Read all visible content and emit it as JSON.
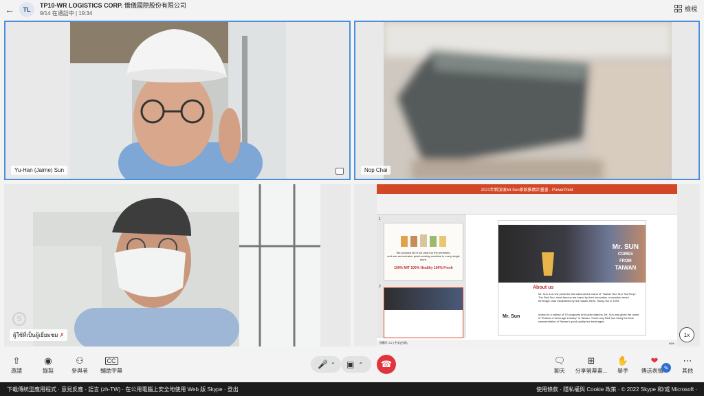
{
  "header": {
    "avatar_initials": "TL",
    "title": "TP10-WR LOGISTICS CORP.",
    "org": "僑儀國際股份有限公司",
    "subtitle": "9/14 在通話中 | 19:34",
    "view_label": "檢視"
  },
  "participants": [
    {
      "name": "Yu-Han (Jaime) Sun"
    },
    {
      "name": "Nop Chai"
    },
    {
      "name": "ผู้ใช้ที่เป็นผู้เยี่ยมชม"
    }
  ],
  "presentation": {
    "window_title": "2021年新加坡Mr.Sun茶飲推廣計畫書 - PowerPoint",
    "slide_heading_1": "Mr. SUN",
    "slide_heading_2": "COMES",
    "slide_heading_3": "FROM",
    "slide_heading_4": "TAIWAN",
    "about_title": "About us",
    "brand_name": "Mr. Sun",
    "about_p1": "Mr. Sun is a new powerful international tea brand of \"Taiwan Red Sun Tea Shop\". The Red Sun, most famous tea brand by their innovation of creative mixed beverage, was established by tea master-thirfs, Tsong-Tse in 1999.",
    "about_p2": "Invited to a variety of TV programs and radio stations, Mr. Sun was given the name of \"Edison of beverage industry\" in Taiwan. That's why Red Sun being the best representative of Taiwan's good-quality tea beverages.",
    "thumb1_line1": "We produce all of our pearl on the premises,",
    "thumb1_line2": "and use an exclusive pearl-cooking machine in every single store.",
    "thumb1_slogan": "100% MIT  100% Healthy  100% Fresh",
    "thumb_index_1": "1",
    "thumb_index_2": "2",
    "status_bar": "投影片 2/2 | 中文(台灣)",
    "zoom": "69%"
  },
  "speed_label": "1x",
  "toolbar": {
    "invite": "邀請",
    "record": "錄製",
    "participants": "參與者",
    "captions": "輔助字幕",
    "chat": "聊天",
    "share": "分享螢幕畫...",
    "raise_hand": "舉手",
    "reactions": "傳送表情...",
    "more": "其他"
  },
  "footer": {
    "links": "下載傳統型應用程式 · 意見反應 · 語言 (zh-TW) · 在公用電腦上安全地使用 Web 版 Skype · 登出",
    "right": "使用條款 · 隱私權與 Cookie 政策 · © 2022 Skype 和/或 Microsoft ·"
  },
  "colors": {
    "accent": "#4a8fd9",
    "end_call": "#e0343f",
    "ppt_orange": "#d24726"
  }
}
